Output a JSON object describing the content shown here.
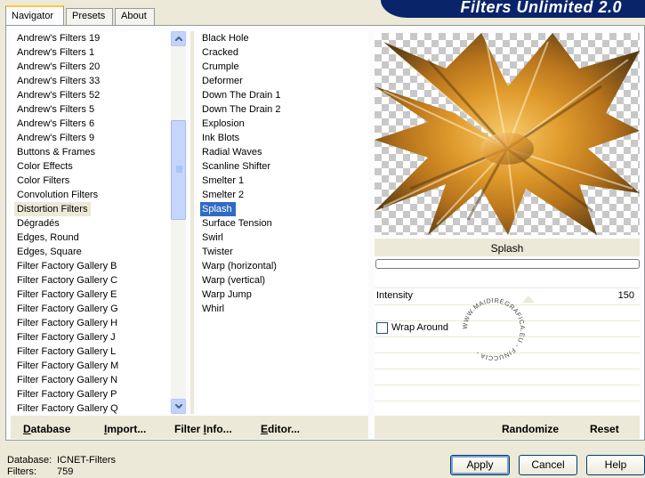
{
  "tabs": [
    {
      "label": "Navigator",
      "active": true
    },
    {
      "label": "Presets",
      "active": false
    },
    {
      "label": "About",
      "active": false
    }
  ],
  "banner": {
    "title": "Filters Unlimited 2.0"
  },
  "categories": {
    "items": [
      "Andrew's Filters 19",
      "Andrew's Filters 1",
      "Andrew's Filters 20",
      "Andrew's Filters 33",
      "Andrew's Filters 52",
      "Andrew's Filters 5",
      "Andrew's Filters 6",
      "Andrew's Filters 9",
      "Buttons & Frames",
      "Color Effects",
      "Color Filters",
      "Convolution Filters",
      "Distortion Filters",
      "Dégradés",
      "Edges, Round",
      "Edges, Square",
      "Filter Factory Gallery B",
      "Filter Factory Gallery C",
      "Filter Factory Gallery E",
      "Filter Factory Gallery G",
      "Filter Factory Gallery H",
      "Filter Factory Gallery J",
      "Filter Factory Gallery L",
      "Filter Factory Gallery M",
      "Filter Factory Gallery N",
      "Filter Factory Gallery P",
      "Filter Factory Gallery Q"
    ],
    "selected": "Distortion Filters"
  },
  "filters": {
    "items": [
      "Black Hole",
      "Cracked",
      "Crumple",
      "Deformer",
      "Down The Drain 1",
      "Down The Drain 2",
      "Explosion",
      "Ink Blots",
      "Radial Waves",
      "Scanline Shifter",
      "Smelter 1",
      "Smelter 2",
      "Splash",
      "Surface Tension",
      "Swirl",
      "Twister",
      "Warp (horizontal)",
      "Warp (vertical)",
      "Warp Jump",
      "Whirl"
    ],
    "selected": "Splash"
  },
  "list_buttons": {
    "database_pre": "",
    "database_u": "D",
    "database_post": "atabase",
    "import_pre": "",
    "import_u": "I",
    "import_post": "mport...",
    "filter_info_pre": "Filter ",
    "filter_info_u": "I",
    "filter_info_post": "nfo...",
    "editor_pre": "",
    "editor_u": "E",
    "editor_post": "ditor..."
  },
  "preview": {
    "filter_name": "Splash"
  },
  "params": {
    "intensity_label": "Intensity",
    "intensity_value": "150",
    "wrap_label": "Wrap Around",
    "wrap_checked": false,
    "watermark_text": "WWW.MAIDIREGRAFICA.EU - FINUCCIA -"
  },
  "right_buttons": {
    "randomize": "Randomize",
    "reset": "Reset"
  },
  "footer": {
    "database_label": "Database:",
    "database_value": "ICNET-Filters",
    "filters_label": "Filters:",
    "filters_value": "759"
  },
  "dialog_buttons": {
    "apply": "Apply",
    "cancel": "Cancel",
    "help": "Help"
  }
}
